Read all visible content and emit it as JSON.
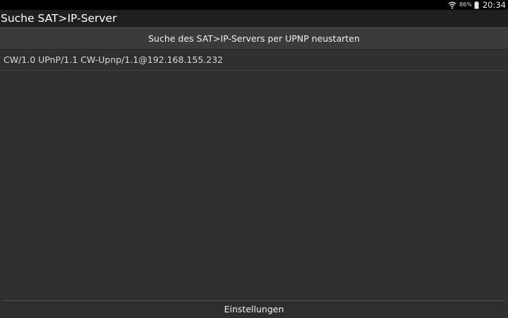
{
  "status_bar": {
    "battery_percent": "86%",
    "time": "20:34",
    "icons": [
      "wifi-icon",
      "battery-icon"
    ]
  },
  "app": {
    "title": "Suche SAT>IP-Server"
  },
  "restart_button": {
    "label": "Suche des SAT>IP-Servers per UPNP neustarten"
  },
  "servers": [
    {
      "label": "CW/1.0 UPnP/1.1 CW-Upnp/1.1@192.168.155.232"
    }
  ],
  "settings_button": {
    "label": "Einstellungen"
  },
  "colors": {
    "background": "#303030",
    "title_bar": "#1f1f1f",
    "status_bar": "#000000",
    "button": "#3b3b3b"
  }
}
